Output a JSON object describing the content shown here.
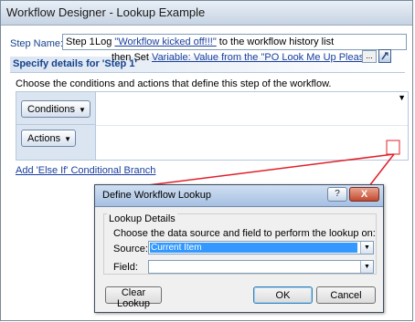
{
  "window": {
    "title": "Workflow Designer - Lookup Example"
  },
  "step": {
    "label": "Step Name:",
    "value": "Step 1"
  },
  "section": {
    "header": "Specify details for 'Step 1'",
    "instructions": "Choose the conditions and actions that define this step of the workflow."
  },
  "rule": {
    "conditions_label": "Conditions",
    "actions_label": "Actions",
    "log_prefix": "Log ",
    "log_link": "\"Workflow kicked off!!!\"",
    "log_suffix": " to the workflow history list",
    "set_prefix": "then Set ",
    "set_link": "Variable: Value from the \"PO Look Me Up Please\" column",
    "ellipsis": "...",
    "add_branch_link": "Add 'Else If' Conditional Branch"
  },
  "dialog": {
    "title": "Define Workflow Lookup",
    "help": "?",
    "close": "X",
    "group_label": "Lookup Details",
    "choose_text": "Choose the data source and field to perform the lookup on:",
    "source_label": "Source:",
    "source_value": "Current Item",
    "field_label": "Field:",
    "field_value": "",
    "clear_button": "Clear Lookup",
    "ok_button": "OK",
    "cancel_button": "Cancel"
  },
  "colors": {
    "header_text": "#15428b",
    "link": "#1a3e9c",
    "callout": "#e0202a",
    "selection": "#3399ff"
  }
}
